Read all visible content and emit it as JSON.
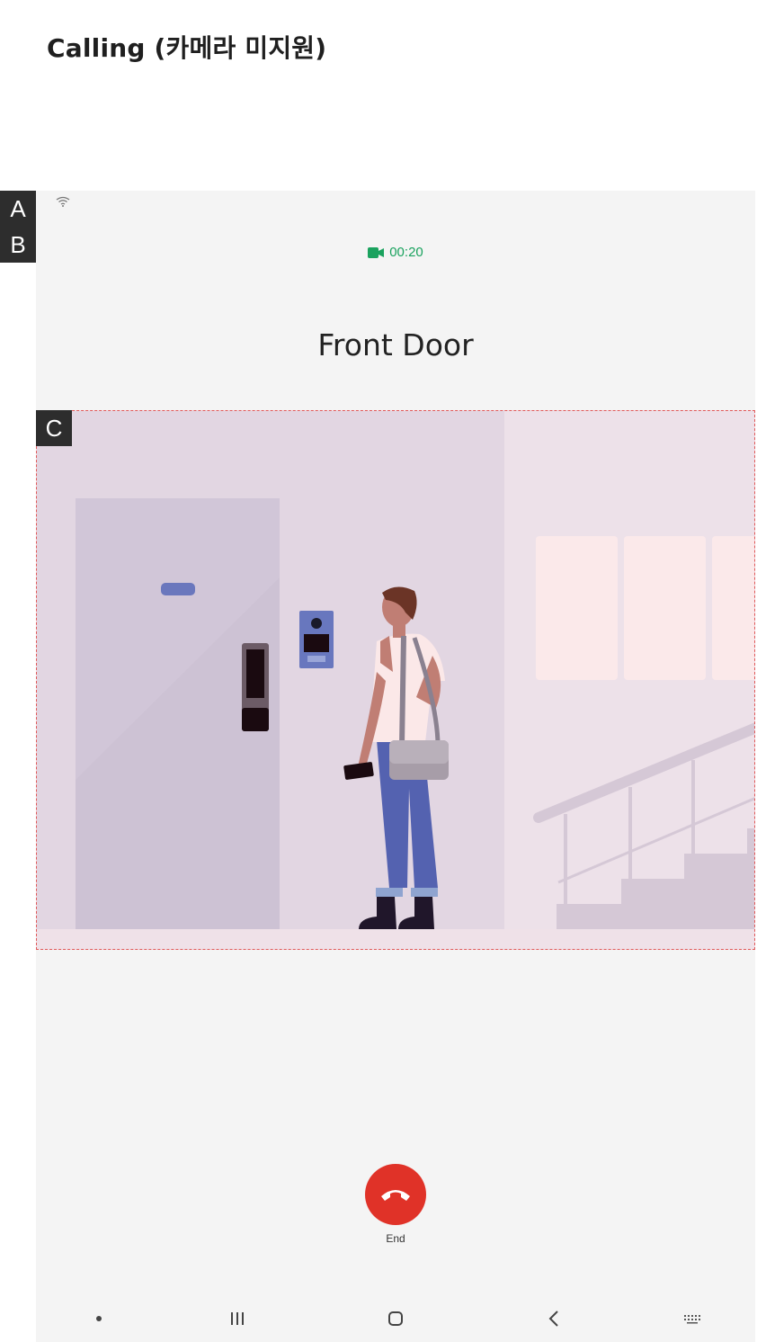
{
  "page": {
    "title": "Calling (카메라 미지원)"
  },
  "markers": {
    "a": "A",
    "b": "B",
    "c": "C"
  },
  "call": {
    "timer": "00:20",
    "device_name": "Front Door",
    "end_label": "End",
    "status_icon": "video-camera-icon",
    "status_color": "#1aa25e",
    "end_color": "#e03228"
  },
  "statusbar": {
    "icon": "wifi-icon"
  },
  "navbar": {
    "items": [
      "dot-icon",
      "recent-apps-icon",
      "home-icon",
      "back-icon",
      "keyboard-icon"
    ]
  }
}
